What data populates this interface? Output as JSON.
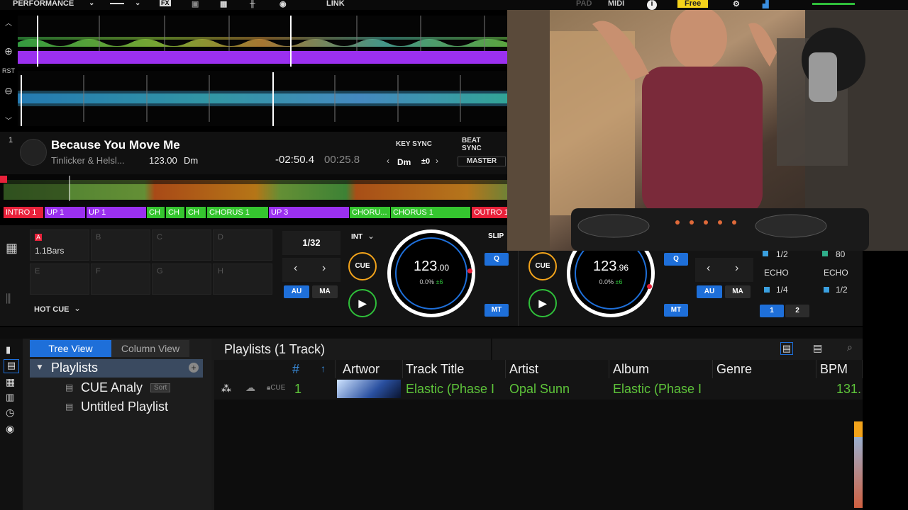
{
  "topbar": {
    "mode": "PERFORMANCE",
    "fx": "FX",
    "link": "LINK",
    "pad": "PAD",
    "midi": "MIDI",
    "plan": "Free"
  },
  "wave_controls": {
    "rst": "RST"
  },
  "deck1": {
    "number": "1",
    "title": "Because You Move Me",
    "artist": "Tinlicker & Helsl...",
    "bpm": "123.00",
    "key": "Dm",
    "remaining": "-02:50.4",
    "elapsed": "00:25.8",
    "key_sync": "KEY SYNC",
    "key_value": "Dm",
    "key_shift": "±0",
    "beat_sync": "BEAT SYNC",
    "master": "MASTER"
  },
  "phrases": [
    "INTRO 1",
    "UP 1",
    "UP 1",
    "CH",
    "CH",
    "CH",
    "CHORUS 1",
    "UP 3",
    "CHORU...",
    "CHORUS 1",
    "OUTRO 1"
  ],
  "pads": {
    "labels": [
      "A",
      "B",
      "C",
      "D",
      "E",
      "F",
      "G",
      "H"
    ],
    "first_pad_value": "1.1Bars",
    "mode": "HOT CUE"
  },
  "deck1_controls": {
    "beat_loop": "1/32",
    "int": "INT",
    "cue": "CUE",
    "slip": "SLIP",
    "q": "Q",
    "au": "AU",
    "ma": "MA",
    "mt": "MT",
    "jog_bpm_int": "123",
    "jog_bpm_dec": ".00",
    "jog_pitch": "0.0%",
    "jog_range": "±6"
  },
  "deck2_controls": {
    "cue": "CUE",
    "q": "Q",
    "au": "AU",
    "ma": "MA",
    "mt": "MT",
    "jog_bpm_int": "123",
    "jog_bpm_dec": ".96",
    "jog_pitch": "0.0%",
    "jog_range": "±6"
  },
  "fx_panel": {
    "row1_left": "1/2",
    "row1_right": "80",
    "echo_left": "ECHO",
    "echo_right": "ECHO",
    "beat_left": "1/4",
    "beat_right": "1/2",
    "tab1": "1",
    "tab2": "2"
  },
  "browser": {
    "tab_tree": "Tree View",
    "tab_column": "Column View",
    "tree_root": "Playlists",
    "tree_items": [
      "CUE Analy",
      "Untitled Playlist"
    ],
    "sort_badge": "Sort",
    "list_title": "Playlists (1 Track)",
    "columns": [
      "#",
      "Artwor",
      "Track Title",
      "Artist",
      "Album",
      "Genre",
      "BPM"
    ],
    "row": {
      "index": "1",
      "cue_tag": "CUE",
      "title": "Elastic (Phase I",
      "artist": "Opal Sunn",
      "album": "Elastic (Phase I",
      "genre": "",
      "bpm": "131."
    }
  },
  "colors": {
    "accent_blue": "#1e6fd9",
    "cue_orange": "#f2a31b",
    "play_green": "#2fbf3a",
    "list_green": "#5ec43a",
    "phrase_red": "#e8213a",
    "phrase_purple": "#9b30f0",
    "phrase_green": "#35c52f",
    "plan_yellow": "#f4d21b"
  }
}
